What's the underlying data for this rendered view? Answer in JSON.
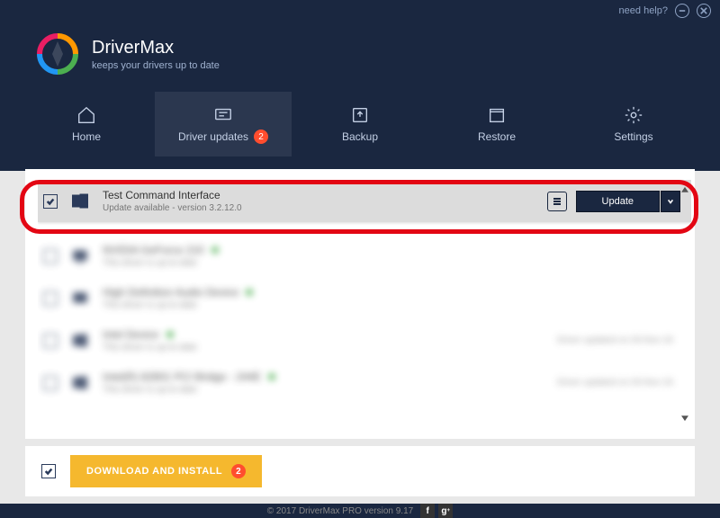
{
  "titlebar": {
    "help": "need help?"
  },
  "brand": {
    "name": "DriverMax",
    "tagline": "keeps your drivers up to date"
  },
  "tabs": [
    {
      "label": "Home"
    },
    {
      "label": "Driver updates",
      "badge": "2"
    },
    {
      "label": "Backup"
    },
    {
      "label": "Restore"
    },
    {
      "label": "Settings"
    }
  ],
  "highlighted": {
    "name": "Test Command Interface",
    "sub": "Update available - version 3.2.12.0",
    "button": "Update"
  },
  "blurred_rows": [
    {
      "name": "NVIDIA GeForce 210",
      "sub": "This driver is up-to-date"
    },
    {
      "name": "High Definition Audio Device",
      "sub": "This driver is up-to-date"
    },
    {
      "name": "Intel Device",
      "sub": "This driver is up-to-date",
      "meta": "Driver updated on 03-Nov-16"
    },
    {
      "name": "Intel(R) 82801 PCI Bridge - 244E",
      "sub": "This driver is up-to-date",
      "meta": "Driver updated on 03-Nov-16"
    }
  ],
  "download": {
    "label": "DOWNLOAD AND INSTALL",
    "badge": "2"
  },
  "footer": {
    "text": "© 2017 DriverMax PRO version 9.17"
  }
}
